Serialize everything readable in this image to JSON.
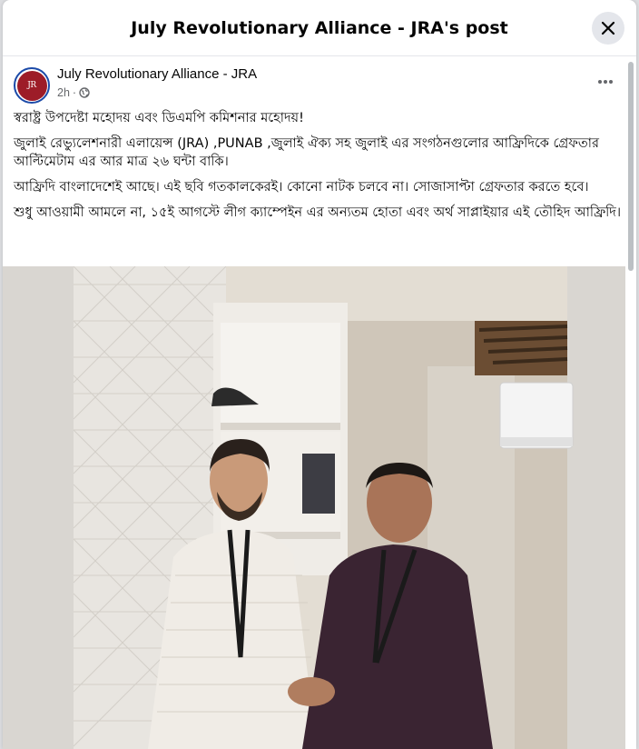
{
  "modal": {
    "title": "July Revolutionary Alliance - JRA's post",
    "close_icon": "close-icon"
  },
  "post": {
    "author": "July Revolutionary Alliance - JRA",
    "avatar_text": "JR",
    "time": "2h",
    "separator": "·",
    "audience_icon": "globe-icon",
    "more_icon": "more-horizontal-icon",
    "paragraphs": [
      "স্বরাষ্ট্র উপদেষ্টা মহোদয় এবং ডিএমপি কমিশনার মহোদয়!",
      " জুলাই রেভ্যুলেশনারী এলায়েন্স (JRA) ,PUNAB ,জুলাই ঐক্য সহ জুলাই এর সংগঠনগুলোর আফ্রিদিকে গ্রেফতার আল্টিমেটাম এর আর মাত্র ২৬ ঘন্টা বাকি।",
      "আফ্রিদি বাংলাদেশেই আছে। এই ছবি গতকালকেরই। কোনো নাটক চলবে না। সোজাসাপ্টা গ্রেফতার করতে হবে।",
      "শুধু আওয়ামী আমলে না, ১৫ই আগস্টে লীগ ক্যাম্পেইন এর অন্যতম হোতা এবং অর্থ সাপ্লাইয়ার এই তৌহিদ আফ্রিদি।"
    ],
    "photo_label": "post-photo"
  },
  "colors": {
    "brand_red": "#9d1c28",
    "avatar_ring": "#1b4aa8",
    "secondary_text": "#65676b"
  }
}
